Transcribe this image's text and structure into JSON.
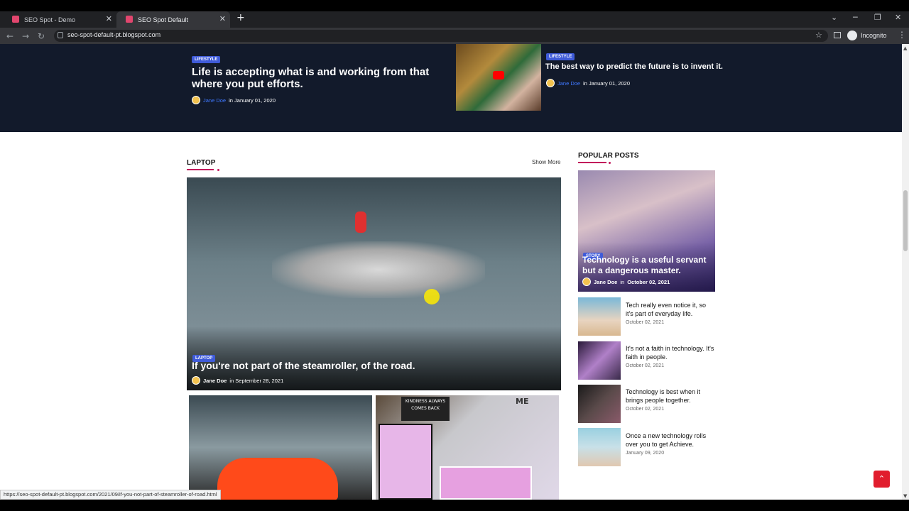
{
  "browser": {
    "tabs": [
      {
        "title": "SEO Spot - Demo"
      },
      {
        "title": "SEO Spot Default"
      }
    ],
    "url": "seo-spot-default-pt.blogspot.com",
    "profile": "Incognito",
    "status_url": "https://seo-spot-default-pt.blogspot.com/2021/09/if-you-not-part-of-steamroller-of-road.html"
  },
  "top_posts": [
    {
      "badge": "LIFESTYLE",
      "title": "Life is accepting what is and working from that where you put efforts.",
      "author": "Jane Doe",
      "meta_in": "in January 01, 2020"
    },
    {
      "badge": "LIFESTYLE",
      "title": "The best way to predict the future is to invent it.",
      "author": "Jane Doe",
      "meta_in": "in January 01, 2020"
    }
  ],
  "laptop_section": {
    "heading": "LAPTOP",
    "show_more": "Show More",
    "hero": {
      "badge": "LAPTOP",
      "title": "If you're not part of the steamroller, of the road.",
      "author": "Jane Doe",
      "meta_in": "in September 28, 2021"
    },
    "tile_text": {
      "kindness": "KINDNESS ALWAYS COMES BACK",
      "me": "ME"
    }
  },
  "popular": {
    "heading": "POPULAR POSTS",
    "feature": {
      "badge": "STORY",
      "title": "Technology is a useful servant but a dangerous master.",
      "author": "Jane Doe",
      "meta_in": "in",
      "date": "October 02, 2021"
    },
    "items": [
      {
        "title": "Tech really even notice it, so it's part of everyday life.",
        "date": "October 02, 2021"
      },
      {
        "title": "It's not a faith in technology. It's faith in people.",
        "date": "October 02, 2021"
      },
      {
        "title": "Technology is best when it brings people together.",
        "date": "October 02, 2021"
      },
      {
        "title": "Once a new technology rolls over you to get Achieve.",
        "date": "January 09, 2020"
      }
    ]
  },
  "colors": {
    "accent": "#c2185b",
    "badge": "#3f5bd9",
    "dark_band": "#121a2b",
    "to_top": "#e11d2d"
  }
}
